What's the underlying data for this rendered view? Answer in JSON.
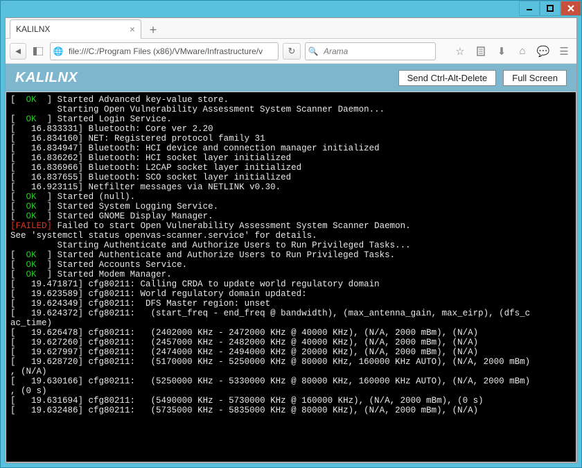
{
  "tab": {
    "title": "KALILNX"
  },
  "url": "file:///C:/Program Files (x86)/VMware/Infrastructure/v",
  "search_placeholder": "Arama",
  "header": {
    "title": "KALILNX",
    "btn_cad": "Send Ctrl-Alt-Delete",
    "btn_fs": "Full Screen"
  },
  "term": {
    "bracket_l": "[",
    "bracket_r": "]",
    "sp2": "  ",
    "sp3": "   ",
    "ok": "OK",
    "fail": "FAILED",
    "lines": [
      " Started Advanced key-value store.",
      "         Starting Open Vulnerability Assessment System Scanner Daemon...",
      " Started Login Service.",
      "16.833331] Bluetooth: Core ver 2.20",
      "16.834160] NET: Registered protocol family 31",
      "16.834947] Bluetooth: HCI device and connection manager initialized",
      "16.836262] Bluetooth: HCI socket layer initialized",
      "16.836966] Bluetooth: L2CAP socket layer initialized",
      "16.837655] Bluetooth: SCO socket layer initialized",
      "16.923115] Netfilter messages via NETLINK v0.30.",
      " Started (null).",
      " Started System Logging Service.",
      " Started GNOME Display Manager.",
      " Failed to start Open Vulnerability Assessment System Scanner Daemon.",
      "See 'systemctl status openvas-scanner.service' for details.",
      "         Starting Authenticate and Authorize Users to Run Privileged Tasks...",
      " Started Authenticate and Authorize Users to Run Privileged Tasks.",
      " Started Accounts Service.",
      " Started Modem Manager.",
      "19.471871] cfg80211: Calling CRDA to update world regulatory domain",
      "19.623589] cfg80211: World regulatory domain updated:",
      "19.624349] cfg80211:  DFS Master region: unset",
      "19.624372] cfg80211:   (start_freq - end_freq @ bandwidth), (max_antenna_gain, max_eirp), (dfs_c",
      "ac_time)",
      "19.626478] cfg80211:   (2402000 KHz - 2472000 KHz @ 40000 KHz), (N/A, 2000 mBm), (N/A)",
      "19.627260] cfg80211:   (2457000 KHz - 2482000 KHz @ 40000 KHz), (N/A, 2000 mBm), (N/A)",
      "19.627997] cfg80211:   (2474000 KHz - 2494000 KHz @ 20000 KHz), (N/A, 2000 mBm), (N/A)",
      "19.628720] cfg80211:   (5170000 KHz - 5250000 KHz @ 80000 KHz, 160000 KHz AUTO), (N/A, 2000 mBm)",
      ", (N/A)",
      "19.630166] cfg80211:   (5250000 KHz - 5330000 KHz @ 80000 KHz, 160000 KHz AUTO), (N/A, 2000 mBm)",
      ", (0 s)",
      "19.631694] cfg80211:   (5490000 KHz - 5730000 KHz @ 160000 KHz), (N/A, 2000 mBm), (0 s)",
      "19.632486] cfg80211:   (5735000 KHz - 5835000 KHz @ 80000 KHz), (N/A, 2000 mBm), (N/A)"
    ]
  }
}
